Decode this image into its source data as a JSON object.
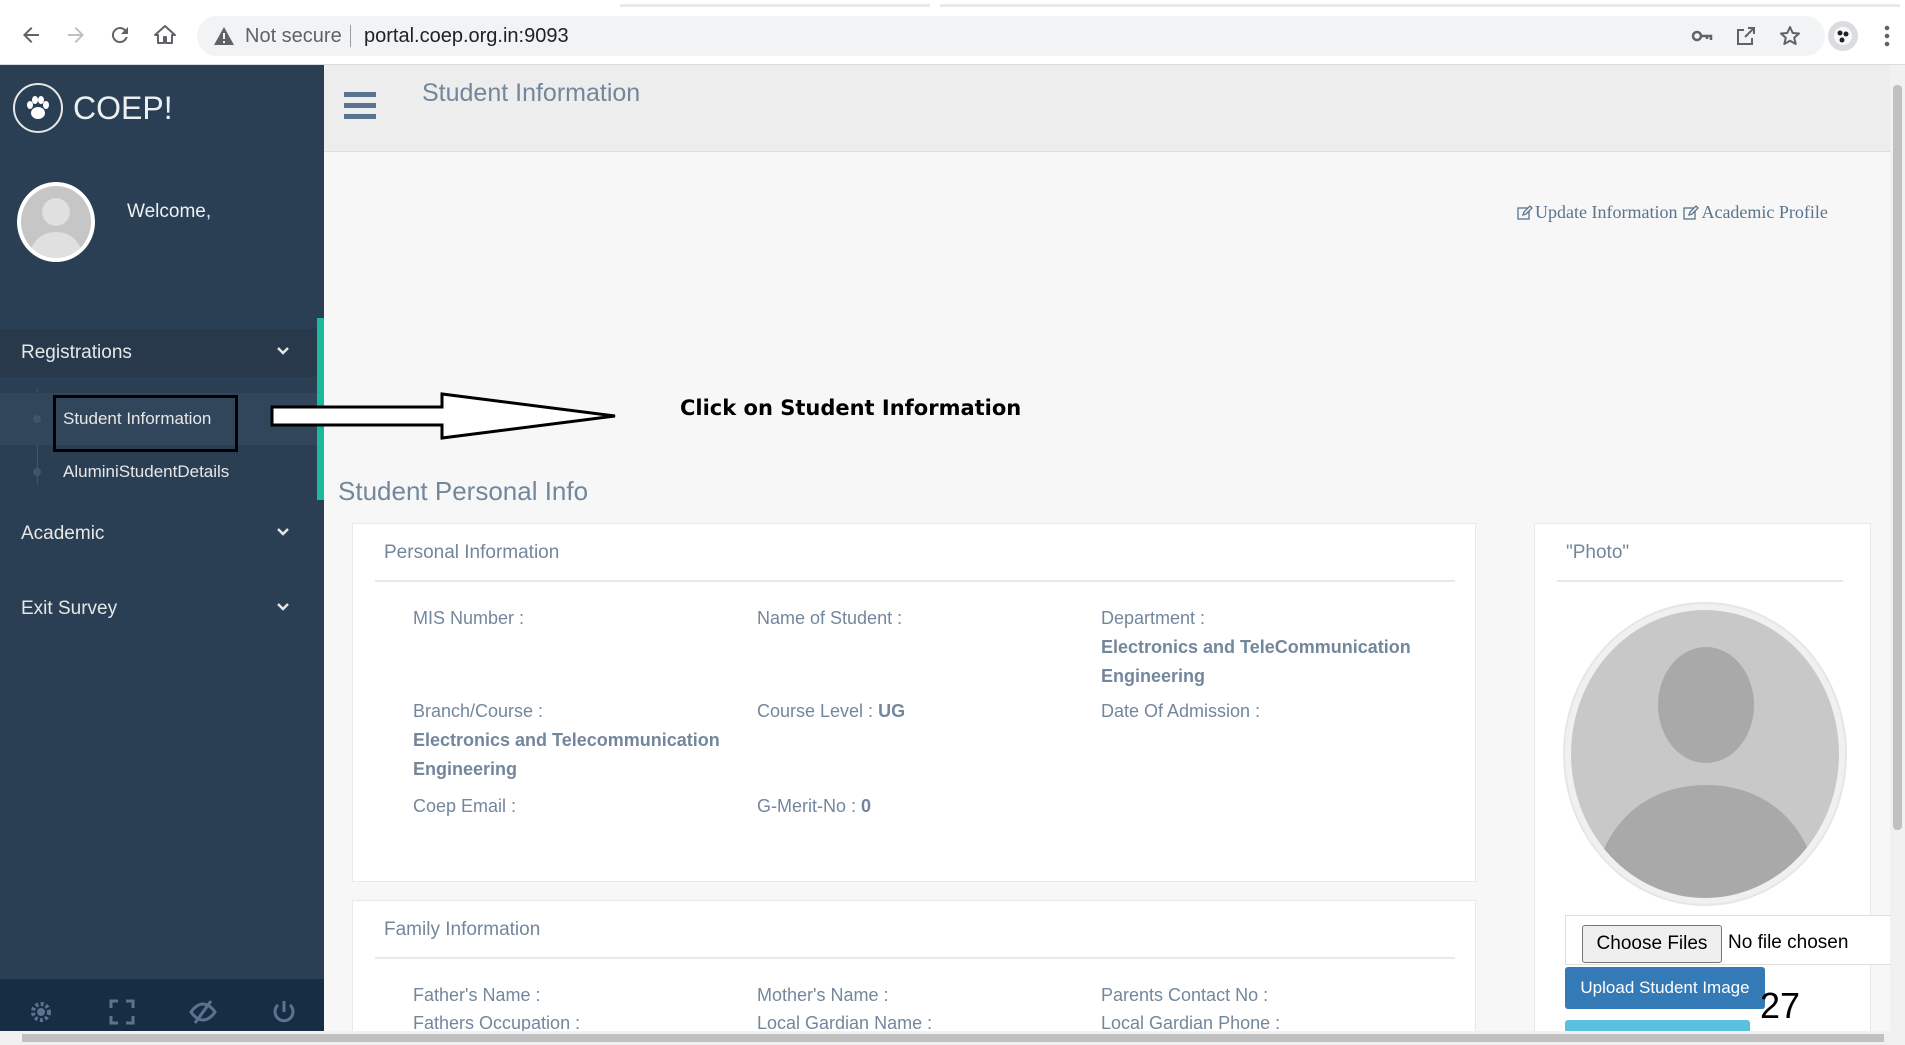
{
  "browser": {
    "security_label": "Not secure",
    "url": "portal.coep.org.in:9093"
  },
  "sidebar": {
    "brand": "COEP!",
    "welcome": "Welcome,",
    "sections": [
      {
        "label": "Registrations"
      },
      {
        "label": "Academic"
      },
      {
        "label": "Exit Survey"
      }
    ],
    "submenu": [
      {
        "label": "Student Information"
      },
      {
        "label": "AluminiStudentDetails"
      }
    ]
  },
  "header": {
    "title": "Student Information"
  },
  "links": {
    "update": "Update Information",
    "academic": "Academic Profile"
  },
  "annotation": "Click on Student Information",
  "main": {
    "section_title": "Student Personal Info",
    "personal": {
      "title": "Personal Information",
      "mis_label": "MIS Number :",
      "name_label": "Name of Student :",
      "dept_label": "Department :",
      "dept_value": "Electronics and TeleCommunication Engineering",
      "branch_label": "Branch/Course :",
      "branch_value": "Electronics and Telecommunication Engineering",
      "level_label": "Course Level :",
      "level_value": "UG",
      "admission_label": "Date Of Admission :",
      "email_label": "Coep Email :",
      "merit_label": "G-Merit-No :",
      "merit_value": "0"
    },
    "family": {
      "title": "Family Information",
      "father_name": "Father's Name :",
      "mother_name": "Mother's Name :",
      "parents_contact": "Parents Contact No :",
      "father_occupation": "Fathers Occupation :",
      "guardian_name": "Local Gardian Name :",
      "guardian_phone": "Local Gardian Phone :"
    },
    "photo": {
      "title": "\"Photo\"",
      "choose_label": "Choose Files",
      "no_file": "No file chosen",
      "upload_label": "Upload Student Image"
    }
  },
  "page_number": "27",
  "colors": {
    "sidebar": "#2a3f54",
    "accent": "#1abb9c",
    "upload_button": "#337ab7"
  }
}
